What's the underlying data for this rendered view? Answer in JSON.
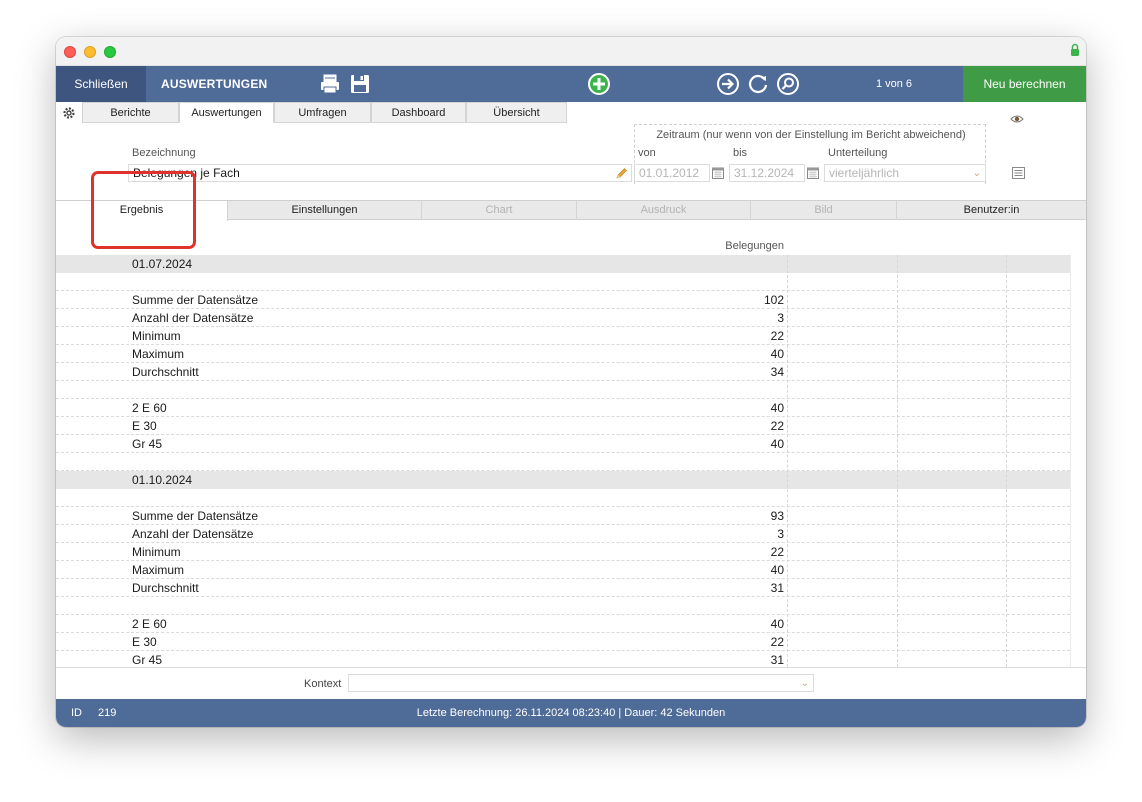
{
  "toolbar": {
    "close_label": "Schließen",
    "title": "AUSWERTUNGEN",
    "record_counter": "1 von 6",
    "recalc_label": "Neu berechnen"
  },
  "top_tabs": [
    {
      "label": "Berichte"
    },
    {
      "label": "Auswertungen"
    },
    {
      "label": "Umfragen"
    },
    {
      "label": "Dashboard"
    },
    {
      "label": "Übersicht"
    }
  ],
  "form": {
    "bezeichnung_label": "Bezeichnung",
    "bezeichnung_value": "Belegungen je Fach",
    "zeitraum_label": "Zeitraum (nur wenn von der Einstellung im Bericht abweichend)",
    "von_label": "von",
    "von_value": "01.01.2012",
    "bis_label": "bis",
    "bis_value": "31.12.2024",
    "unterteilung_label": "Unterteilung",
    "unterteilung_value": "vierteljährlich"
  },
  "sub_tabs": [
    {
      "label": "Ergebnis"
    },
    {
      "label": "Einstellungen"
    },
    {
      "label": "Chart"
    },
    {
      "label": "Ausdruck"
    },
    {
      "label": "Bild"
    },
    {
      "label": "Benutzer:in"
    }
  ],
  "results": {
    "column_header": "Belegungen",
    "rows": [
      {
        "type": "group",
        "label": "01.07.2024",
        "value": ""
      },
      {
        "type": "blank",
        "label": "",
        "value": ""
      },
      {
        "type": "data",
        "label": "Summe der Datensätze",
        "value": "102"
      },
      {
        "type": "data",
        "label": "Anzahl der Datensätze",
        "value": "3"
      },
      {
        "type": "data",
        "label": "Minimum",
        "value": "22"
      },
      {
        "type": "data",
        "label": "Maximum",
        "value": "40"
      },
      {
        "type": "data",
        "label": "Durchschnitt",
        "value": "34"
      },
      {
        "type": "blank",
        "label": "",
        "value": ""
      },
      {
        "type": "data",
        "label": "2 E 60",
        "value": "40"
      },
      {
        "type": "data",
        "label": "E 30",
        "value": "22"
      },
      {
        "type": "data",
        "label": "Gr 45",
        "value": "40"
      },
      {
        "type": "blank",
        "label": "",
        "value": ""
      },
      {
        "type": "group",
        "label": "01.10.2024",
        "value": ""
      },
      {
        "type": "blank",
        "label": "",
        "value": ""
      },
      {
        "type": "data",
        "label": "Summe der Datensätze",
        "value": "93"
      },
      {
        "type": "data",
        "label": "Anzahl der Datensätze",
        "value": "3"
      },
      {
        "type": "data",
        "label": "Minimum",
        "value": "22"
      },
      {
        "type": "data",
        "label": "Maximum",
        "value": "40"
      },
      {
        "type": "data",
        "label": "Durchschnitt",
        "value": "31"
      },
      {
        "type": "blank",
        "label": "",
        "value": ""
      },
      {
        "type": "data",
        "label": "2 E 60",
        "value": "40"
      },
      {
        "type": "data",
        "label": "E 30",
        "value": "22"
      },
      {
        "type": "data",
        "label": "Gr 45",
        "value": "31"
      }
    ]
  },
  "kontext": {
    "label": "Kontext",
    "value": ""
  },
  "status": {
    "id_label": "ID",
    "id_value": "219",
    "message": "Letzte Berechnung: 26.11.2024 08:23:40  |  Dauer: 42 Sekunden"
  },
  "colors": {
    "toolbar_blue": "#4f6c99",
    "close_button_blue": "#3e5580",
    "recalc_green": "#3f9b46",
    "add_icon_green": "#3cb44b",
    "highlight_red": "#e0322d"
  },
  "icons": [
    "lock-icon",
    "printer-icon",
    "save-icon",
    "add-icon",
    "next-icon",
    "refresh-icon",
    "search-icon",
    "gear-icon",
    "eye-icon",
    "pencil-icon",
    "calendar-icon",
    "chevron-down-icon",
    "list-icon"
  ]
}
